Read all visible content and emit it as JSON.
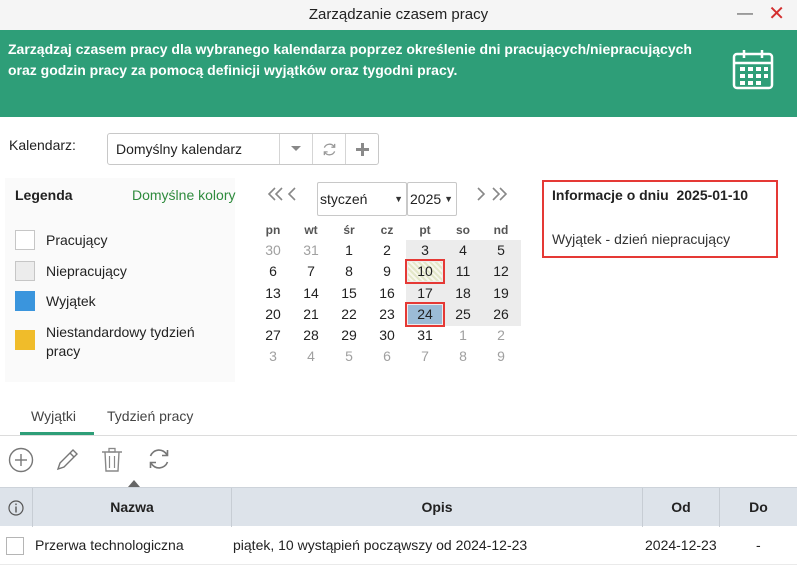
{
  "window": {
    "title": "Zarządzanie czasem pracy",
    "minimize": "—",
    "close": "✕"
  },
  "banner": {
    "text": "Zarządzaj czasem pracy dla wybranego kalendarza poprzez określenie dni pracujących/niepracujących oraz godzin pracy za pomocą definicji wyjątków oraz tygodni pracy.",
    "icon": "calendar-icon"
  },
  "calendar_selector": {
    "label": "Kalendarz:",
    "value": "Domyślny kalendarz"
  },
  "legend": {
    "title": "Legenda",
    "default_colors": "Domyślne kolory",
    "items": [
      {
        "label": "Pracujący",
        "color": "#ffffff"
      },
      {
        "label": "Niepracujący",
        "color": "#ececec"
      },
      {
        "label": "Wyjątek",
        "color": "#3a95dd"
      },
      {
        "label": "Niestandardowy tydzień pracy",
        "color": "#f0bc2a"
      }
    ]
  },
  "calendar": {
    "month": "styczeń",
    "year": "2025",
    "weekdays": [
      "pn",
      "wt",
      "śr",
      "cz",
      "pt",
      "so",
      "nd"
    ],
    "weeks": [
      [
        "30",
        "31",
        "1",
        "2",
        "3",
        "4",
        "5"
      ],
      [
        "6",
        "7",
        "8",
        "9",
        "10",
        "11",
        "12"
      ],
      [
        "13",
        "14",
        "15",
        "16",
        "17",
        "18",
        "19"
      ],
      [
        "20",
        "21",
        "22",
        "23",
        "24",
        "25",
        "26"
      ],
      [
        "27",
        "28",
        "29",
        "30",
        "31",
        "1",
        "2"
      ],
      [
        "3",
        "4",
        "5",
        "6",
        "7",
        "8",
        "9"
      ]
    ]
  },
  "day_info": {
    "title": "Informacje o dniu",
    "date": "2025-01-10",
    "description": "Wyjątek - dzień niepracujący"
  },
  "tabs": [
    {
      "label": "Wyjątki",
      "active": true
    },
    {
      "label": "Tydzień pracy",
      "active": false
    }
  ],
  "toolbar": {
    "add": "add-icon",
    "edit": "edit-icon",
    "delete": "delete-icon",
    "refresh": "refresh-icon"
  },
  "table": {
    "columns": [
      "Nazwa",
      "Opis",
      "Od",
      "Do"
    ],
    "rows": [
      {
        "name": "Przerwa technologiczna",
        "description": "piątek, 10 wystąpień począwszy od 2024-12-23",
        "from": "2024-12-23",
        "to": "-"
      }
    ]
  }
}
